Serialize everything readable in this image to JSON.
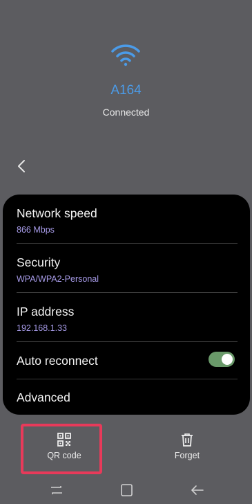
{
  "network": {
    "ssid": "A164",
    "status": "Connected"
  },
  "details": {
    "speed_label": "Network speed",
    "speed_value": "866 Mbps",
    "security_label": "Security",
    "security_value": "WPA/WPA2-Personal",
    "ip_label": "IP address",
    "ip_value": "192.168.1.33",
    "auto_reconnect_label": "Auto reconnect",
    "auto_reconnect_on": true,
    "advanced_label": "Advanced"
  },
  "actions": {
    "qr_label": "QR code",
    "forget_label": "Forget"
  },
  "icons": {
    "wifi": "wifi-icon",
    "back": "back-chevron-icon",
    "qr": "qr-code-icon",
    "forget": "trash-icon",
    "recents": "recents-icon",
    "home": "home-icon",
    "nav_back": "nav-back-icon"
  },
  "colors": {
    "accent": "#4b9be8",
    "subtext": "#a79be8",
    "toggle_on": "#6a9a6a",
    "highlight": "#e83a5a"
  }
}
